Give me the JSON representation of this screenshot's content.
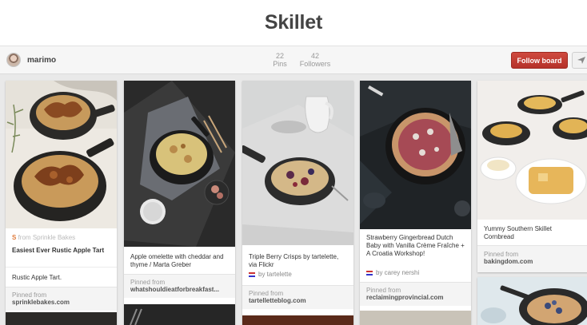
{
  "board": {
    "title": "Skillet",
    "owner": "marimo",
    "pins_count": "22",
    "pins_label": "Pins",
    "followers_count": "42",
    "followers_label": "Followers",
    "follow_label": "Follow board"
  },
  "pins": [
    {
      "via_prefix": "from",
      "via_name": "Sprinkle Bakes",
      "title": "Easiest Ever Rustic Apple Tart",
      "note": "Rustic Apple Tart.",
      "pinned_label": "Pinned from",
      "domain": "sprinklebakes.com"
    },
    {
      "description": "Apple omelette with cheddar and thyme / Marta Greber",
      "pinned_label": "Pinned from",
      "domain": "whatshouldieatforbreakfast..."
    },
    {
      "description": "Triple Berry Crisps by tartelette, via Flickr",
      "credit": "by tartelette",
      "pinned_label": "Pinned from",
      "domain": "tartelletteblog.com"
    },
    {
      "description": "Strawberry Gingerbread Dutch Baby with Vanilla Crème Fraîche + A Croatia Workshop!",
      "credit": "by carey nershi",
      "pinned_label": "Pinned from",
      "domain": "reclaimingprovincial.com"
    },
    {
      "description": "Yummy Southern Skillet Cornbread",
      "pinned_label": "Pinned from",
      "domain": "bakingdom.com"
    }
  ],
  "colors": {
    "follow_button": "#b5322a",
    "background": "#e9e9e9",
    "skillet_iron": "#2a2a2a"
  },
  "icons": [
    "send-icon",
    "sprinkle-bakes-icon",
    "flag-icon"
  ]
}
